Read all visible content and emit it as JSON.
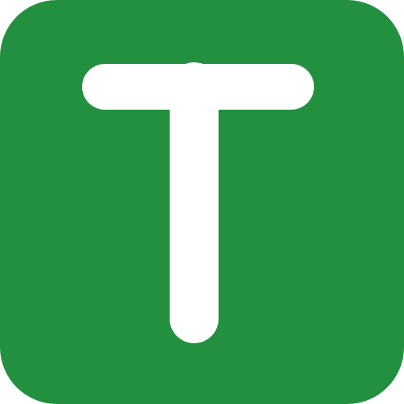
{
  "app_icon": {
    "letter": "T",
    "icon_name": "letter-t-icon",
    "colors": {
      "background": "#22903f",
      "glyph": "#ffffff"
    }
  }
}
